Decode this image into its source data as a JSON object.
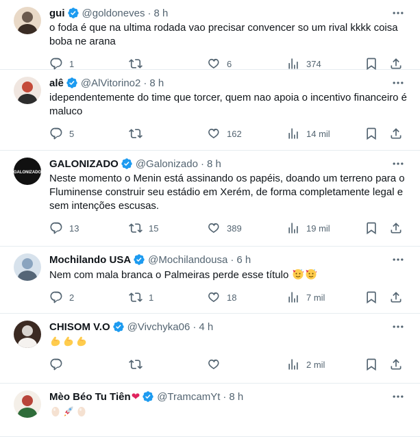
{
  "tweets": [
    {
      "name": "gui",
      "handle": "@goldoneves",
      "time": "8 h",
      "text": "o foda é que na ultima rodada vao precisar convencer so um rival kkkk coisa boba ne arana",
      "replies": "1",
      "retweets": "",
      "likes": "6",
      "views": "374",
      "avatar_color": "#6b5a4e"
    },
    {
      "name": "alê",
      "handle": "@AlVitorino2",
      "time": "8 h",
      "text": "idependentemente do time que torcer, quem nao apoia o incentivo financeiro é maluco",
      "replies": "5",
      "retweets": "",
      "likes": "162",
      "views": "14 mil",
      "avatar_color": "#c44b3a"
    },
    {
      "name": "GALONIZADO",
      "handle": "@Galonizado",
      "time": "8 h",
      "text": "Neste momento o Menin está assinando os papéis, doando um terreno para o Fluminense construir seu estádio em Xerém, de forma completamente legal e sem intenções escusas.",
      "replies": "13",
      "retweets": "15",
      "likes": "389",
      "views": "19 mil",
      "avatar_color": "#111111",
      "avatar_text": "GALONIZADO"
    },
    {
      "name": "Mochilando USA",
      "handle": "@Mochilandousa",
      "time": "6 h",
      "text": "Nem com mala branca o Palmeiras perde esse título",
      "emojis": [
        "party-face",
        "party-face"
      ],
      "replies": "2",
      "retweets": "1",
      "likes": "18",
      "views": "7 mil",
      "avatar_color": "#8aa4bf"
    },
    {
      "name": "CHISOM V.O",
      "handle": "@Vivchyka06",
      "time": "4 h",
      "text": "",
      "emojis": [
        "flexed-biceps",
        "flexed-biceps",
        "flexed-biceps"
      ],
      "replies": "",
      "retweets": "",
      "likes": "",
      "views": "2 mil",
      "avatar_color": "#d9d4cf"
    },
    {
      "name": "Mèo Béo Tu Tiên",
      "name_heart": "❤",
      "handle": "@TramcamYt",
      "time": "8 h",
      "text": "",
      "emojis": [
        "egg",
        "rocket",
        "egg"
      ],
      "avatar_color": "#b8453a"
    }
  ],
  "colors": {
    "accent": "#1d9bf0",
    "muted": "#536471",
    "text": "#0f1419",
    "heart": "#e0245e"
  }
}
